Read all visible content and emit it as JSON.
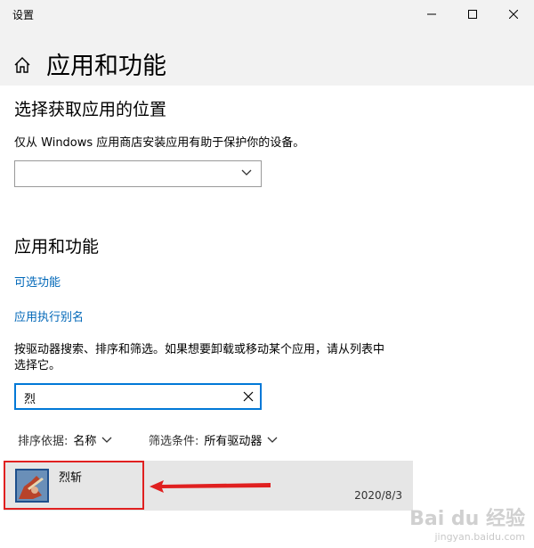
{
  "window": {
    "title": "设置",
    "controls": [
      "minimize-icon",
      "maximize-icon",
      "close-icon"
    ]
  },
  "header": {
    "home_icon": "home-icon",
    "title": "应用和功能"
  },
  "install_section": {
    "heading": "选择获取应用的位置",
    "description": "仅从 Windows 应用商店安装应用有助于保护你的设备。",
    "dropdown_value": ""
  },
  "apps_section": {
    "heading": "应用和功能",
    "links": [
      "可选功能",
      "应用执行别名"
    ],
    "instructions_line1": "按驱动器搜索、排序和筛选。如果想要卸载或移动某个应用，请从列表中",
    "instructions_line2": "选择它。",
    "search_value": "烈",
    "sort_label": "排序依据:",
    "sort_value": "名称",
    "filter_label": "筛选条件:",
    "filter_value": "所有驱动器"
  },
  "app_list": [
    {
      "name": "烈斩",
      "date": "2020/8/3"
    }
  ],
  "watermark": {
    "brand": "Bai du 经验",
    "url": "jingyan.baidu.com"
  },
  "colors": {
    "accent": "#0078d7",
    "link": "#0067b8",
    "highlight": "#e02020",
    "chrome": "#f2f2f2"
  }
}
